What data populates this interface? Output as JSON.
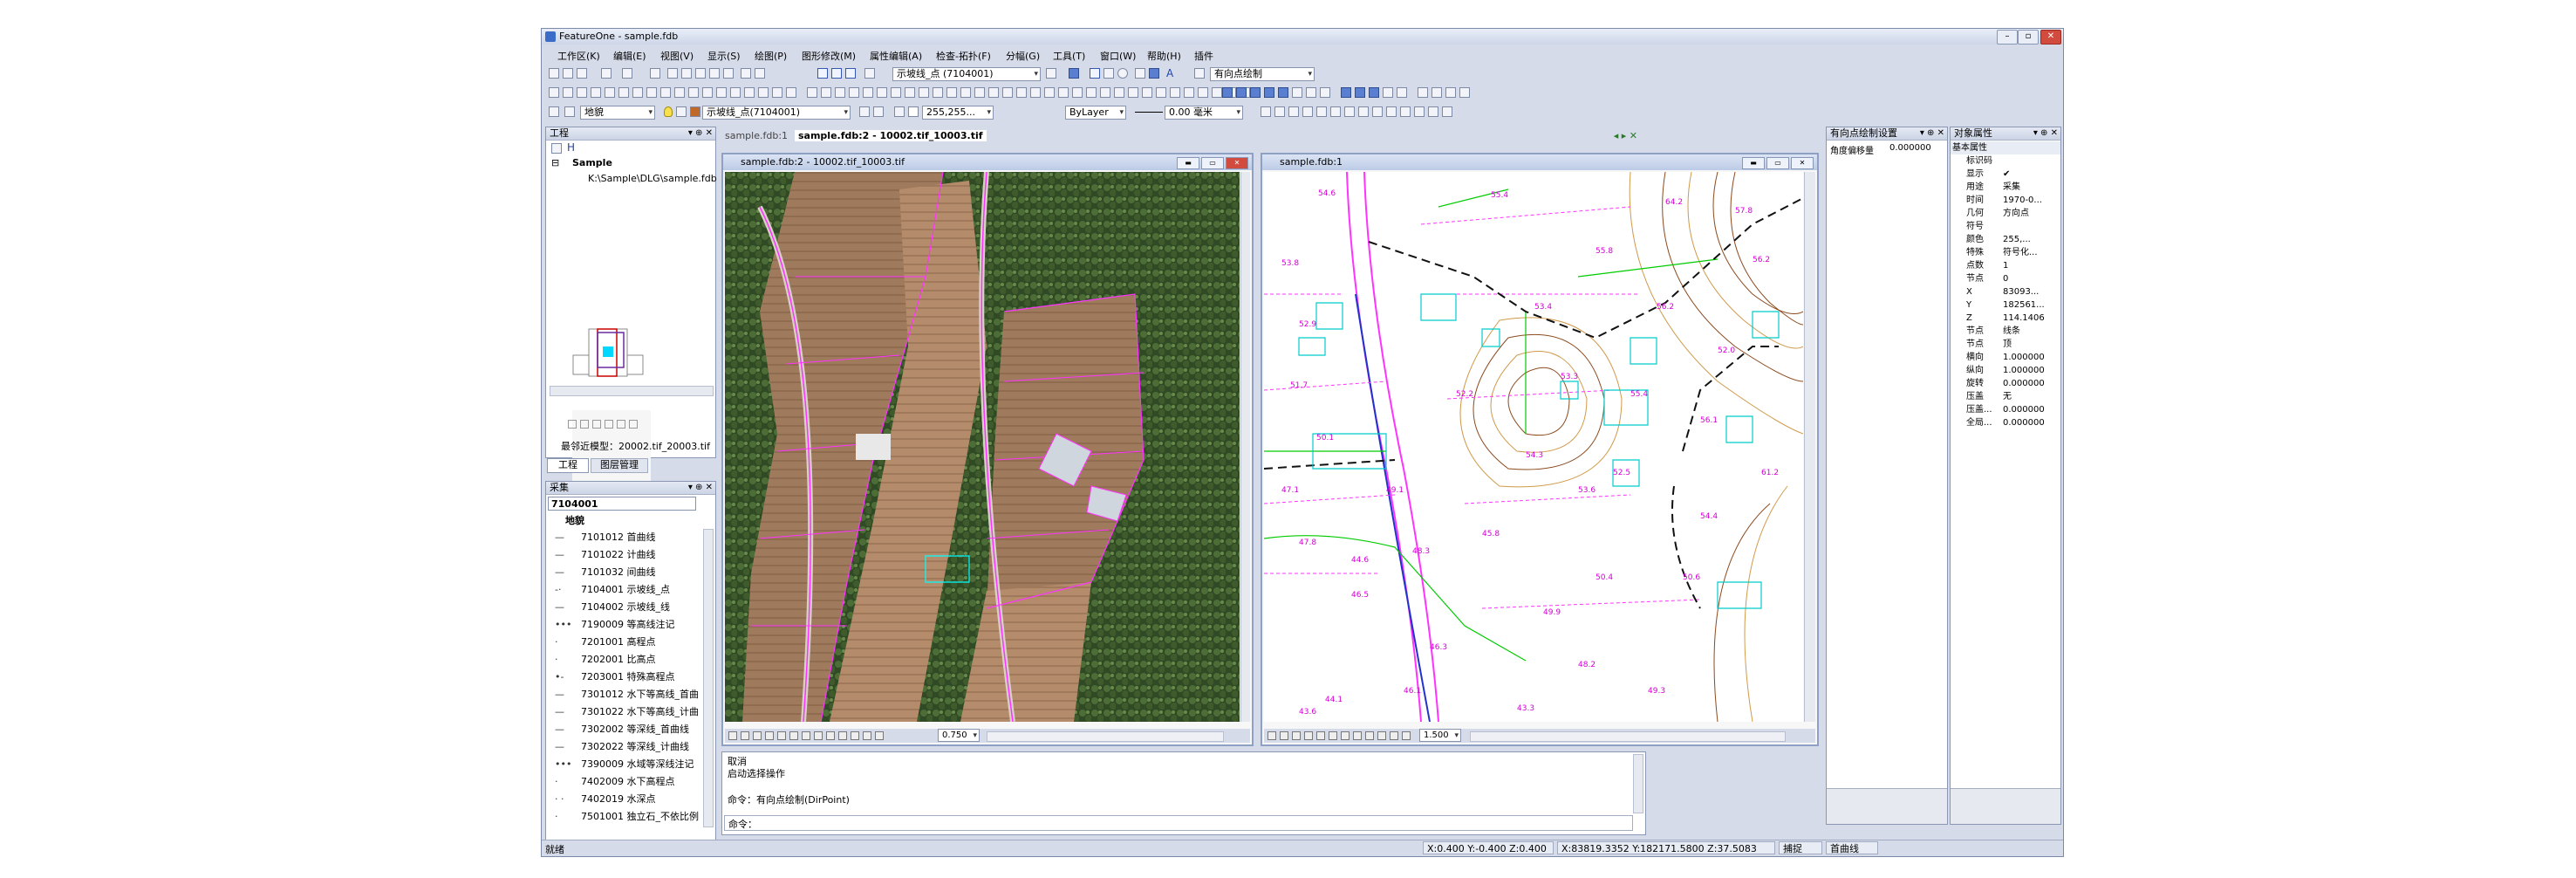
{
  "window": {
    "title": "FeatureOne - sample.fdb"
  },
  "menu": [
    "工作区(K)",
    "编辑(E)",
    "视图(V)",
    "显示(S)",
    "绘图(P)",
    "图形修改(M)",
    "属性编辑(A)",
    "检查-拓扑(F)",
    "分幅(G)",
    "工具(T)",
    "窗口(W)",
    "帮助(H)",
    "插件"
  ],
  "toolbar": {
    "layer_combo": "示坡线_点 (7104001)",
    "draw_combo": "有向点绘制",
    "layer_class_combo": "地貌",
    "layer_code_combo": "示坡线_点(7104001)",
    "color_combo": "255,255...",
    "linetype_combo": "ByLayer",
    "linewidth_combo": "0.00 毫米"
  },
  "project_panel": {
    "title": "工程",
    "root": "Sample",
    "child": "K:\\Sample\\DLG\\sample.fdb",
    "recent_model": "最邻近模型：20002.tif_20003.tif",
    "tabs": [
      "工程",
      "图层管理"
    ]
  },
  "collect_panel": {
    "title": "采集",
    "search_value": "7104001",
    "group": "地貌",
    "items": [
      {
        "sym": "—",
        "label": "7101012 首曲线"
      },
      {
        "sym": "—",
        "label": "7101022 计曲线"
      },
      {
        "sym": "—",
        "label": "7101032 间曲线"
      },
      {
        "sym": "-·",
        "label": "7104001 示坡线_点"
      },
      {
        "sym": "—",
        "label": "7104002 示坡线_线"
      },
      {
        "sym": "•••",
        "label": "7190009 等高线注记"
      },
      {
        "sym": "·",
        "label": "7201001 高程点"
      },
      {
        "sym": "·",
        "label": "7202001 比高点"
      },
      {
        "sym": "•-",
        "label": "7203001 特殊高程点"
      },
      {
        "sym": "—",
        "label": "7301012 水下等高线_首曲"
      },
      {
        "sym": "—",
        "label": "7301022 水下等高线_计曲"
      },
      {
        "sym": "—",
        "label": "7302002 等深线_首曲线"
      },
      {
        "sym": "—",
        "label": "7302022 等深线_计曲线"
      },
      {
        "sym": "•••",
        "label": "7390009 水域等深线注记"
      },
      {
        "sym": "·",
        "label": "7402009 水下高程点"
      },
      {
        "sym": "· ·",
        "label": "7402019 水深点"
      },
      {
        "sym": "·",
        "label": "7501001 独立石_不依比例"
      }
    ]
  },
  "doc_tabs": [
    "sample.fdb:1",
    "sample.fdb:2 - 10002.tif_10003.tif"
  ],
  "image_window": {
    "title": "sample.fdb:2 - 10002.tif_10003.tif",
    "zoom": "0.750"
  },
  "vector_window": {
    "title": "sample.fdb:1",
    "zoom": "1.500"
  },
  "map_labels": [
    "54.6",
    "55.4",
    "64.2",
    "57.8",
    "53.8",
    "55.8",
    "56.2",
    "53.4",
    "52.9",
    "56.2",
    "51.7",
    "52.2",
    "53.3",
    "55.4",
    "56.1",
    "50.1",
    "54.3",
    "52.5",
    "53.6",
    "49.1",
    "47.8",
    "48.3",
    "50.4",
    "50.6",
    "46.5",
    "49.9",
    "46.3",
    "48.2",
    "44.1",
    "46.1",
    "49.3",
    "43.6",
    "44.6",
    "47.1",
    "52.0",
    "54.4",
    "61.2",
    "45.8",
    "43.3"
  ],
  "command": {
    "lines": [
      "取消",
      "启动选择操作",
      "",
      "命令：有向点绘制(DirPoint)",
      "命令："
    ]
  },
  "direction_panel": {
    "title": "有向点绘制设置",
    "key": "角度偏移量",
    "value": "0.000000"
  },
  "props_panel": {
    "title": "对象属性",
    "section": "基本属性",
    "rows": [
      {
        "k": "标识码",
        "v": ""
      },
      {
        "k": "显示",
        "v": "✔"
      },
      {
        "k": "用途",
        "v": "采集"
      },
      {
        "k": "时间",
        "v": "1970-0..."
      },
      {
        "k": "几何",
        "v": "方向点"
      },
      {
        "k": "符号",
        "v": ""
      },
      {
        "k": "颜色",
        "v": "255,..."
      },
      {
        "k": "特殊",
        "v": "符号化..."
      },
      {
        "k": "点数",
        "v": "1"
      },
      {
        "k": "节点",
        "v": "0"
      },
      {
        "k": "X",
        "v": "83093..."
      },
      {
        "k": "Y",
        "v": "182561..."
      },
      {
        "k": "Z",
        "v": "114.1406"
      },
      {
        "k": "节点",
        "v": "线条"
      },
      {
        "k": "节点",
        "v": "顶"
      },
      {
        "k": "横向",
        "v": "1.000000"
      },
      {
        "k": "纵向",
        "v": "1.000000"
      },
      {
        "k": "旋转",
        "v": "0.000000"
      },
      {
        "k": "压盖",
        "v": "无"
      },
      {
        "k": "压盖...",
        "v": "0.000000"
      },
      {
        "k": "全局...",
        "v": "0.000000"
      }
    ]
  },
  "status": {
    "ready": "就绪",
    "offset": "X:0.400 Y:-0.400 Z:0.400",
    "coords": "X:83819.3352 Y:182171.5800 Z:37.5083",
    "snap": "捕捉",
    "mode": "首曲线"
  }
}
